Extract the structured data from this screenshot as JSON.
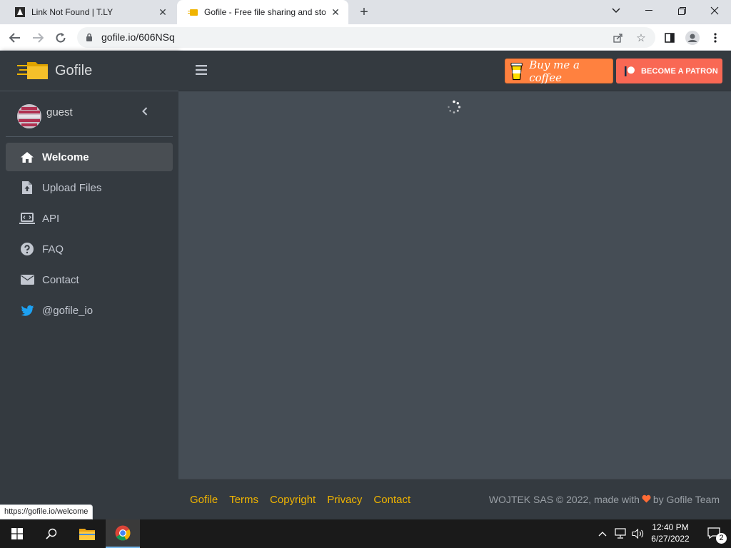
{
  "browser": {
    "tabs": [
      {
        "title": "Link Not Found | T.LY",
        "active": false
      },
      {
        "title": "Gofile - Free file sharing and stor",
        "active": true
      }
    ],
    "url": "gofile.io/606NSq",
    "status_url": "https://gofile.io/welcome"
  },
  "sidebar": {
    "brand": "Gofile",
    "user": "guest",
    "items": [
      {
        "label": "Welcome",
        "icon": "home-icon",
        "active": true
      },
      {
        "label": "Upload Files",
        "icon": "file-upload-icon",
        "active": false
      },
      {
        "label": "API",
        "icon": "laptop-code-icon",
        "active": false
      },
      {
        "label": "FAQ",
        "icon": "question-circle-icon",
        "active": false
      },
      {
        "label": "Contact",
        "icon": "envelope-icon",
        "active": false
      },
      {
        "label": "@gofile_io",
        "icon": "twitter-icon",
        "active": false
      }
    ]
  },
  "topbar": {
    "bmc_label": "Buy me a coffee",
    "patron_label": "BECOME A PATRON"
  },
  "footer": {
    "links": [
      "Gofile",
      "Terms",
      "Copyright",
      "Privacy",
      "Contact"
    ],
    "credit_prefix": "WOJTEK SAS © 2022, made with",
    "credit_suffix": "by Gofile Team"
  },
  "taskbar": {
    "time": "12:40 PM",
    "date": "6/27/2022",
    "notification_count": "2"
  },
  "colors": {
    "sidebar_bg": "#343a40",
    "content_bg": "#454d55",
    "footer_link": "#f0b400",
    "bmc": "#ff813f",
    "patron": "#f96854"
  }
}
